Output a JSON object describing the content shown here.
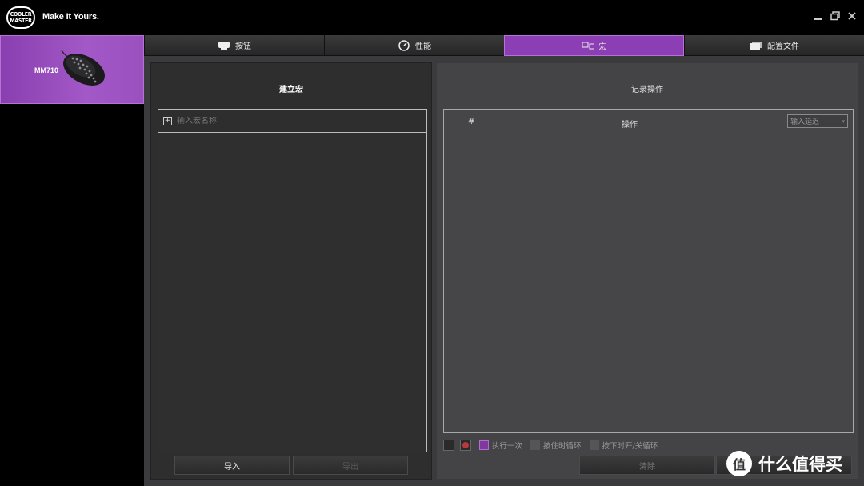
{
  "app": {
    "logo_lines": [
      "COOLER",
      "MASTER"
    ],
    "tagline": "Make It Yours.",
    "window_controls": {
      "minimize": "minimize-icon",
      "restore": "restore-icon",
      "close": "close-icon"
    }
  },
  "sidebar": {
    "device": {
      "name": "MM710",
      "selected": true
    }
  },
  "tabs": [
    {
      "label": "按钮",
      "icon": "mouse-icon",
      "active": false
    },
    {
      "label": "性能",
      "icon": "gauge-icon",
      "active": false
    },
    {
      "label": "宏",
      "icon": "macro-icon",
      "active": true
    },
    {
      "label": "配置文件",
      "icon": "profile-icon",
      "active": false
    }
  ],
  "create_macro": {
    "title": "建立宏",
    "name_placeholder": "输入宏名称",
    "import_label": "导入",
    "export_label": "导出"
  },
  "record": {
    "title": "记录操作",
    "col_hash": "#",
    "col_action": "操作",
    "delay_placeholder": "输入延迟",
    "options": {
      "run_once": "执行一次",
      "loop_while_held": "按住时循环",
      "toggle_loop": "按下时开/关循环"
    },
    "clear_label": "清除"
  },
  "watermark": {
    "icon_glyph": "值",
    "text": "什么值得买"
  },
  "colors": {
    "accent": "#8c3fb5",
    "background": "#000000",
    "panel": "#3b3b3d"
  }
}
